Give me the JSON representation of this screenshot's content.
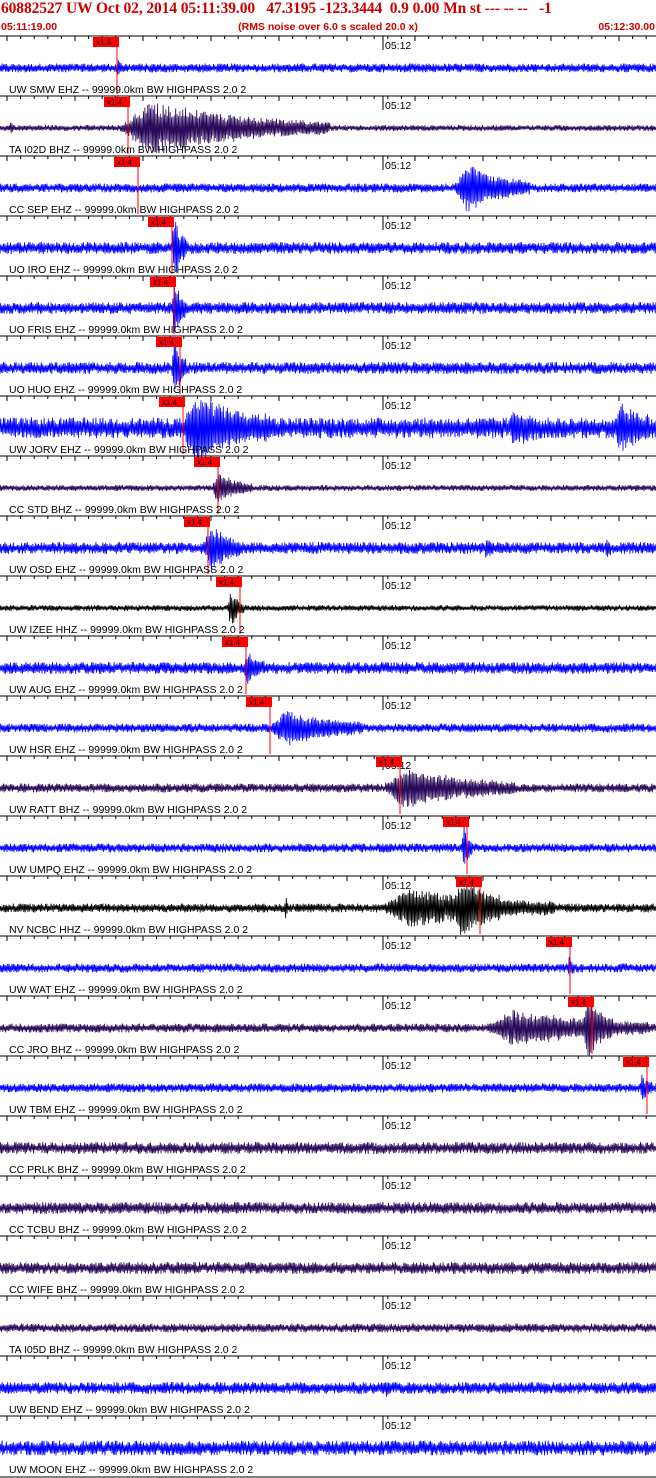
{
  "header": {
    "title": "60882527 UW Oct 02, 2014 05:11:39.00   47.3195 -123.3444  0.9 0.00 Mn st --- -- --   -1",
    "subtitle": "(RMS noise over 6.0 s scaled 20.0 x)",
    "time_start": "05:11:19.00",
    "time_end": "05:12:30.00"
  },
  "colors": {
    "header_text": "#cc0000",
    "pick": "#ff0000",
    "blue": "#0000ff",
    "purple": "#2a0a5a",
    "black": "#000000"
  },
  "chart_data": {
    "type": "line",
    "title": "60882527 UW Oct 02, 2014 05:11:39.00   47.3195 -123.3444  0.9 0.00 Mn st --- -- --   -1",
    "x_range": [
      "05:11:19.00",
      "05:12:30.00"
    ],
    "minute_tick_label": "05:12",
    "pick_label": "x1.4",
    "series": [
      {
        "name": "UW SMW EHZ -- 99999.0km BW  HIGHPASS  2.0  2",
        "color": "blue",
        "pick_x": 117,
        "noise": 3,
        "events": [
          {
            "x": 117,
            "amp": 8,
            "dur": 5
          }
        ]
      },
      {
        "name": "TA I02D BHZ -- 99999.0km BW  HIGHPASS  2.0  2",
        "color": "purple",
        "pick_x": 128,
        "noise": 2,
        "events": [
          {
            "x": 10,
            "amp": 6,
            "dur": 4
          },
          {
            "x": 120,
            "amp": 26,
            "dur": 210
          }
        ]
      },
      {
        "name": "CC SEP EHZ -- 99999.0km BW  HIGHPASS  2.0  2",
        "color": "blue",
        "pick_x": 138,
        "noise": 3,
        "events": [
          {
            "x": 455,
            "amp": 22,
            "dur": 75
          }
        ]
      },
      {
        "name": "UO IRO EHZ -- 99999.0km BW  HIGHPASS  2.0  2",
        "color": "blue",
        "pick_x": 172,
        "noise": 4,
        "events": [
          {
            "x": 172,
            "amp": 30,
            "dur": 15
          }
        ]
      },
      {
        "name": "UO FRIS EHZ -- 99999.0km BW  HIGHPASS  2.0  2",
        "color": "blue",
        "pick_x": 174,
        "noise": 4,
        "events": [
          {
            "x": 172,
            "amp": 30,
            "dur": 14
          }
        ]
      },
      {
        "name": "UO HUO EHZ -- 99999.0km BW  HIGHPASS  2.0  2",
        "color": "blue",
        "pick_x": 180,
        "noise": 4,
        "events": [
          {
            "x": 172,
            "amp": 30,
            "dur": 14
          }
        ]
      },
      {
        "name": "UW JORV EHZ -- 99999.0km BW  HIGHPASS  2.0  2",
        "color": "blue",
        "pick_x": 183,
        "noise": 7,
        "events": [
          {
            "x": 183,
            "amp": 28,
            "dur": 90
          },
          {
            "x": 510,
            "amp": 12,
            "dur": 30
          },
          {
            "x": 615,
            "amp": 20,
            "dur": 35
          }
        ]
      },
      {
        "name": "CC STD BHZ -- 99999.0km BW  HIGHPASS  2.0  2",
        "color": "purple",
        "pick_x": 218,
        "noise": 2,
        "events": [
          {
            "x": 212,
            "amp": 14,
            "dur": 40
          }
        ]
      },
      {
        "name": "UW OSD EHZ -- 99999.0km BW  HIGHPASS  2.0  2",
        "color": "blue",
        "pick_x": 208,
        "noise": 4,
        "events": [
          {
            "x": 205,
            "amp": 22,
            "dur": 35
          },
          {
            "x": 485,
            "amp": 10,
            "dur": 8
          },
          {
            "x": 605,
            "amp": 8,
            "dur": 6
          }
        ]
      },
      {
        "name": "UW IZEE HHZ -- 99999.0km BW  HIGHPASS  2.0  2",
        "color": "black",
        "pick_x": 240,
        "noise": 2,
        "events": [
          {
            "x": 228,
            "amp": 20,
            "dur": 16
          }
        ]
      },
      {
        "name": "UW AUG EHZ -- 99999.0km BW  HIGHPASS  2.0  2",
        "color": "blue",
        "pick_x": 246,
        "noise": 4,
        "events": [
          {
            "x": 244,
            "amp": 14,
            "dur": 20
          }
        ]
      },
      {
        "name": "UW HSR EHZ -- 99999.0km BW  HIGHPASS  2.0  2",
        "color": "blue",
        "pick_x": 270,
        "noise": 3,
        "events": [
          {
            "x": 272,
            "amp": 16,
            "dur": 90
          }
        ]
      },
      {
        "name": "UW RATT BHZ -- 99999.0km BW  HIGHPASS  2.0  2",
        "color": "purple",
        "pick_x": 400,
        "noise": 3,
        "events": [
          {
            "x": 385,
            "amp": 18,
            "dur": 130
          }
        ]
      },
      {
        "name": "UW UMPQ EHZ -- 99999.0km BW  HIGHPASS  2.0  2",
        "color": "blue",
        "pick_x": 467,
        "noise": 3,
        "events": [
          {
            "x": 462,
            "amp": 24,
            "dur": 10
          }
        ]
      },
      {
        "name": "NV NCBC HHZ -- 99999.0km BW  HIGHPASS  2.0  2",
        "color": "black",
        "pick_x": 480,
        "noise": 3,
        "events": [
          {
            "x": 285,
            "amp": 14,
            "dur": 3
          },
          {
            "x": 385,
            "amp": 18,
            "dur": 170
          },
          {
            "x": 455,
            "amp": 24,
            "dur": 45
          }
        ]
      },
      {
        "name": "UW WAT EHZ -- 99999.0km BW  HIGHPASS  2.0  2",
        "color": "blue",
        "pick_x": 570,
        "noise": 3,
        "events": [
          {
            "x": 568,
            "amp": 9,
            "dur": 6
          }
        ]
      },
      {
        "name": "CC JRO BHZ -- 99999.0km BW  HIGHPASS  2.0  2",
        "color": "purple",
        "pick_x": 592,
        "noise": 3,
        "events": [
          {
            "x": 488,
            "amp": 16,
            "dur": 160
          },
          {
            "x": 583,
            "amp": 26,
            "dur": 30
          }
        ]
      },
      {
        "name": "UW TBM EHZ -- 99999.0km BW  HIGHPASS  2.0  2",
        "color": "blue",
        "pick_x": 647,
        "noise": 3,
        "events": [
          {
            "x": 640,
            "amp": 12,
            "dur": 12
          }
        ]
      },
      {
        "name": "CC PRLK BHZ -- 99999.0km BW  HIGHPASS  2.0  2",
        "color": "purple",
        "pick_x": null,
        "noise": 4,
        "events": []
      },
      {
        "name": "CC TCBU BHZ -- 99999.0km BW  HIGHPASS  2.0  2",
        "color": "purple",
        "pick_x": null,
        "noise": 4,
        "events": []
      },
      {
        "name": "CC WIFE BHZ -- 99999.0km BW  HIGHPASS  2.0  2",
        "color": "purple",
        "pick_x": null,
        "noise": 4,
        "events": []
      },
      {
        "name": "TA I05D BHZ -- 99999.0km BW  HIGHPASS  2.0  2",
        "color": "purple",
        "pick_x": null,
        "noise": 3,
        "events": []
      },
      {
        "name": "UW BEND EHZ -- 99999.0km BW  HIGHPASS  2.0  2",
        "color": "blue",
        "pick_x": null,
        "noise": 4,
        "events": [
          {
            "x": 385,
            "amp": 6,
            "dur": 4
          }
        ]
      },
      {
        "name": "UW MOON EHZ -- 99999.0km BW  HIGHPASS  2.0  2",
        "color": "blue",
        "pick_x": null,
        "noise": 5,
        "events": []
      }
    ]
  }
}
